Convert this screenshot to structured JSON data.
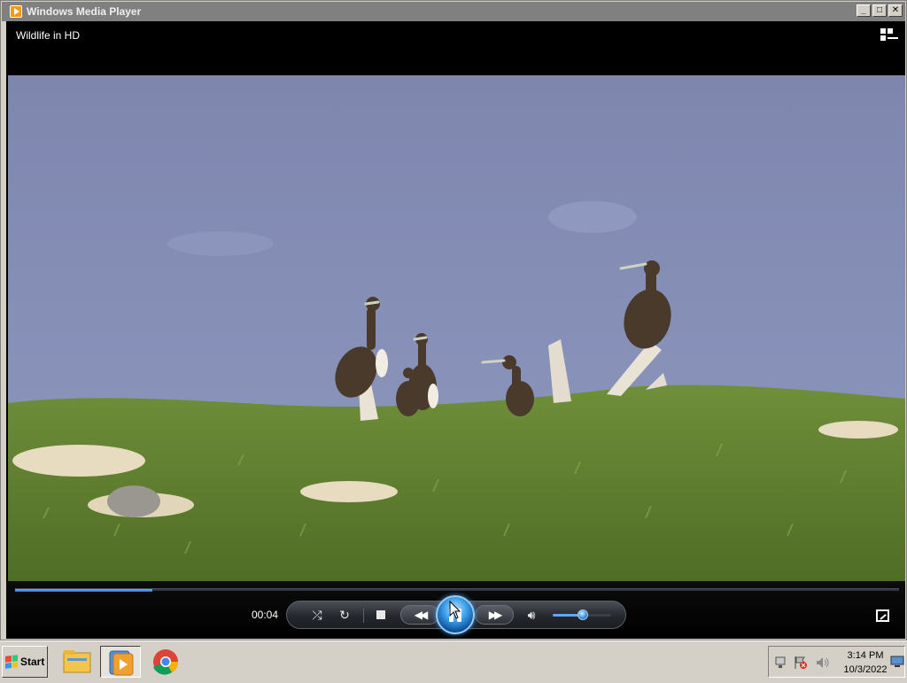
{
  "window": {
    "title": "Windows Media Player",
    "controls": {
      "minimize": "_",
      "maximize": "□",
      "close": "✕"
    }
  },
  "player": {
    "now_playing": "Wildlife in HD",
    "elapsed_time": "00:04",
    "seek_progress_fraction": 0.155,
    "volume_fraction": 0.5,
    "state": "playing"
  },
  "icons": {
    "shuffle": "shuffle-icon",
    "repeat": "repeat-icon",
    "stop": "stop-icon",
    "previous": "rewind-icon",
    "play_pause": "pause-icon",
    "next": "fast-forward-icon",
    "mute": "speaker-icon",
    "fullscreen": "fullscreen-icon",
    "switch_to_library": "switch-to-library-icon"
  },
  "colors": {
    "titlebar": "#808080",
    "player_bg": "#000000",
    "seek_fill": "#3d8be8",
    "play_button": "#2f8ae0"
  },
  "taskbar": {
    "start_label": "Start",
    "pinned": [
      "file-explorer-icon",
      "windows-media-player-icon",
      "chrome-icon"
    ],
    "clock_time": "3:14 PM",
    "clock_date": "10/3/2022",
    "tray_icons": [
      "network-icon",
      "action-center-flag-icon",
      "volume-icon",
      "show-desktop-icon"
    ]
  }
}
